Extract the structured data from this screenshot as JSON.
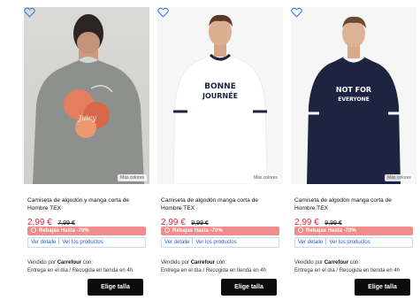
{
  "products": [
    {
      "more_colors": "Más colores",
      "title": "Camiseta de algodón y manga corta de Hombre TEX",
      "price": "2,99 €",
      "old_price": "7,99 €",
      "promo": "Rebajas Hasta -70%",
      "view_detail": "Ver detalle",
      "view_products": "Ver los productos",
      "sold_by_prefix": "Vendido por ",
      "seller": "Carrefour",
      "sold_by_suffix": " con:",
      "delivery": "Entrega en el día /  Recogida en tienda en 4h",
      "cta": "Elige talla"
    },
    {
      "more_colors": "Más colores",
      "title": "Camiseta de algodón manga corta de Hombre TEX",
      "price": "2,99 €",
      "old_price": "9,99 €",
      "promo": "Rebajas Hasta -70%",
      "view_detail": "Ver detalle",
      "view_products": "Ver los productos",
      "sold_by_prefix": "Vendido por ",
      "seller": "Carrefour",
      "sold_by_suffix": " con:",
      "delivery": "Entrega en el día /  Recogida en tienda en 4h",
      "cta": "Elige talla",
      "shirt_print": [
        "BONNE",
        "JOURNÉE"
      ]
    },
    {
      "more_colors": "Más colores",
      "title": "Camiseta de algodón manga corta de Hombre TEX",
      "price": "2,99 €",
      "old_price": "9,99 €",
      "promo": "Rebajas Hasta -70%",
      "view_detail": "Ver detalle",
      "view_products": "Ver los productos",
      "sold_by_prefix": "Vendido por ",
      "seller": "Carrefour",
      "sold_by_suffix": " con:",
      "delivery": "Entrega en el día /  Recogida en tienda en 4h",
      "cta": "Elige talla",
      "shirt_print": [
        "NOT FOR",
        "EVERYONE"
      ]
    }
  ],
  "colors": {
    "price": "#e2263a",
    "promo_bg": "#f28b8b",
    "link": "#1a5fc8",
    "button_bg": "#0b0b0b",
    "heart": "#3d7be0"
  },
  "icons": {
    "favorite": "heart-outline-icon",
    "promo": "tag-icon"
  }
}
